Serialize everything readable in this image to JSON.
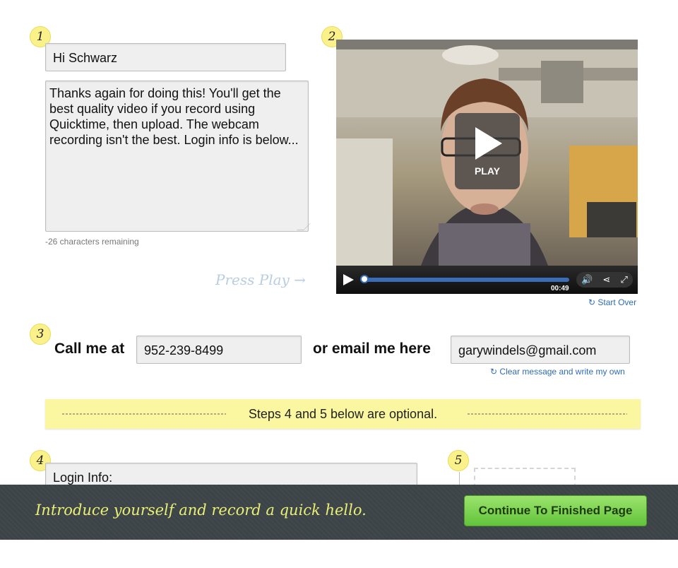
{
  "steps": {
    "one": "1",
    "two": "2",
    "three": "3",
    "four": "4",
    "five": "5"
  },
  "greeting": {
    "value": "Hi Schwarz"
  },
  "message": {
    "value": "Thanks again for doing this! You'll get the best quality video if you record using Quicktime, then upload. The webcam recording isn't the best. Login info is below...",
    "remaining": "-26 characters remaining"
  },
  "video": {
    "press_play_hint": "Press Play →",
    "play_label": "PLAY",
    "time": "00:49",
    "progress": 0.0,
    "start_over": "Start Over"
  },
  "contact": {
    "call_label": "Call me at",
    "phone": "952-239-8499",
    "email_label": "or email me here",
    "email": "garywindels@gmail.com",
    "clear_link": "Clear message and write my own"
  },
  "banner": {
    "text": "Steps 4 and 5 below are optional."
  },
  "login": {
    "value": "Login Info:"
  },
  "footer": {
    "message": "Introduce yourself and record a quick hello.",
    "continue_label": "Continue To Finished Page"
  },
  "colors": {
    "badge": "#fbf18a",
    "banner": "#fbf6a0",
    "bottombar": "#3d4448",
    "footer_text": "#e9ef74",
    "button": "#62c43b",
    "link": "#2f6bb7"
  }
}
